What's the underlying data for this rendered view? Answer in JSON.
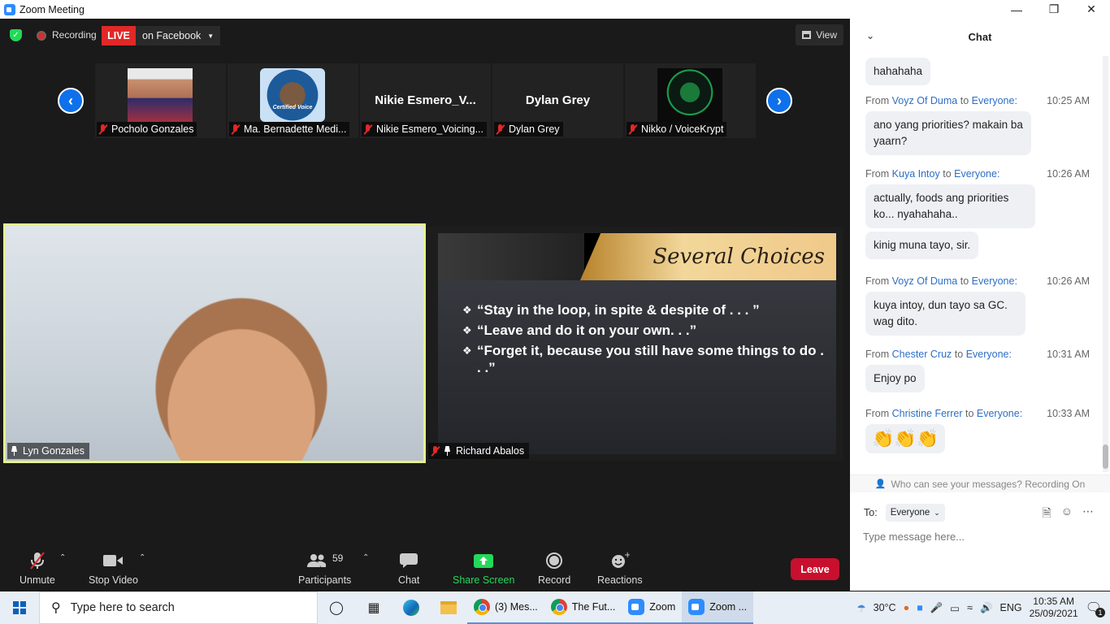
{
  "window": {
    "title": "Zoom Meeting"
  },
  "topbar": {
    "recording_label": "Recording",
    "live_label": "LIVE",
    "live_destination": "on Facebook",
    "view_label": "View"
  },
  "thumbnails": [
    {
      "name": "Pocholo Gonzales",
      "display": "photo"
    },
    {
      "name": "Ma. Bernadette Medi...",
      "display": "photo",
      "photo_caption": "Certified Voice"
    },
    {
      "name": "Nikie Esmero_Voicing...",
      "display": "text",
      "big_name": "Nikie  Esmero_V..."
    },
    {
      "name": "Dylan Grey",
      "display": "text",
      "big_name": "Dylan Grey"
    },
    {
      "name": "Nikko / VoiceKrypt",
      "display": "photo"
    }
  ],
  "main_videos": {
    "left": {
      "name": "Lyn Gonzales"
    },
    "right": {
      "name": "Richard Abalos",
      "slide_title": "Several Choices",
      "bullets": [
        "“Stay in the loop, in spite & despite of . . . ”",
        "“Leave and do it on your own. . .”",
        "“Forget it, because you still have some things to do . . .”"
      ]
    }
  },
  "controls": {
    "unmute": "Unmute",
    "stop_video": "Stop Video",
    "participants": "Participants",
    "participants_count": "59",
    "chat": "Chat",
    "share_screen": "Share Screen",
    "record": "Record",
    "reactions": "Reactions",
    "leave": "Leave"
  },
  "chat": {
    "header": "Chat",
    "first_bubble": "hahahaha",
    "messages": [
      {
        "from_prefix": "From",
        "sender": "Voyz Of Duma",
        "to_word": "to",
        "recipient": "Everyone:",
        "time": "10:25 AM",
        "bubbles": [
          "ano yang priorities? makain ba yaarn?"
        ]
      },
      {
        "from_prefix": "From",
        "sender": "Kuya Intoy",
        "to_word": "to",
        "recipient": "Everyone:",
        "time": "10:26 AM",
        "bubbles": [
          "actually, foods ang priorities ko... nyahahaha..",
          "kinig muna tayo, sir."
        ]
      },
      {
        "from_prefix": "From",
        "sender": "Voyz Of Duma",
        "to_word": "to",
        "recipient": "Everyone:",
        "time": "10:26 AM",
        "bubbles": [
          "kuya intoy, dun tayo sa GC. wag dito."
        ]
      },
      {
        "from_prefix": "From",
        "sender": "Chester Cruz",
        "to_word": "to",
        "recipient": "Everyone:",
        "time": "10:31 AM",
        "bubbles": [
          "Enjoy po"
        ]
      },
      {
        "from_prefix": "From",
        "sender": "Christine Ferrer",
        "to_word": "to",
        "recipient": "Everyone:",
        "time": "10:33 AM",
        "bubbles": [
          "👏👏👏"
        ]
      }
    ],
    "privacy_note": "Who can see your messages? Recording On",
    "to_label": "To:",
    "recipient_select": "Everyone",
    "input_placeholder": "Type message here..."
  },
  "taskbar": {
    "search_placeholder": "Type here to search",
    "apps": [
      {
        "label": "(3) Mes..."
      },
      {
        "label": "The Fut..."
      },
      {
        "label": "Zoom"
      },
      {
        "label": "Zoom ..."
      }
    ],
    "weather": "30°C",
    "language": "ENG",
    "time": "10:35 AM",
    "date": "25/09/2021",
    "notification_count": "1"
  }
}
